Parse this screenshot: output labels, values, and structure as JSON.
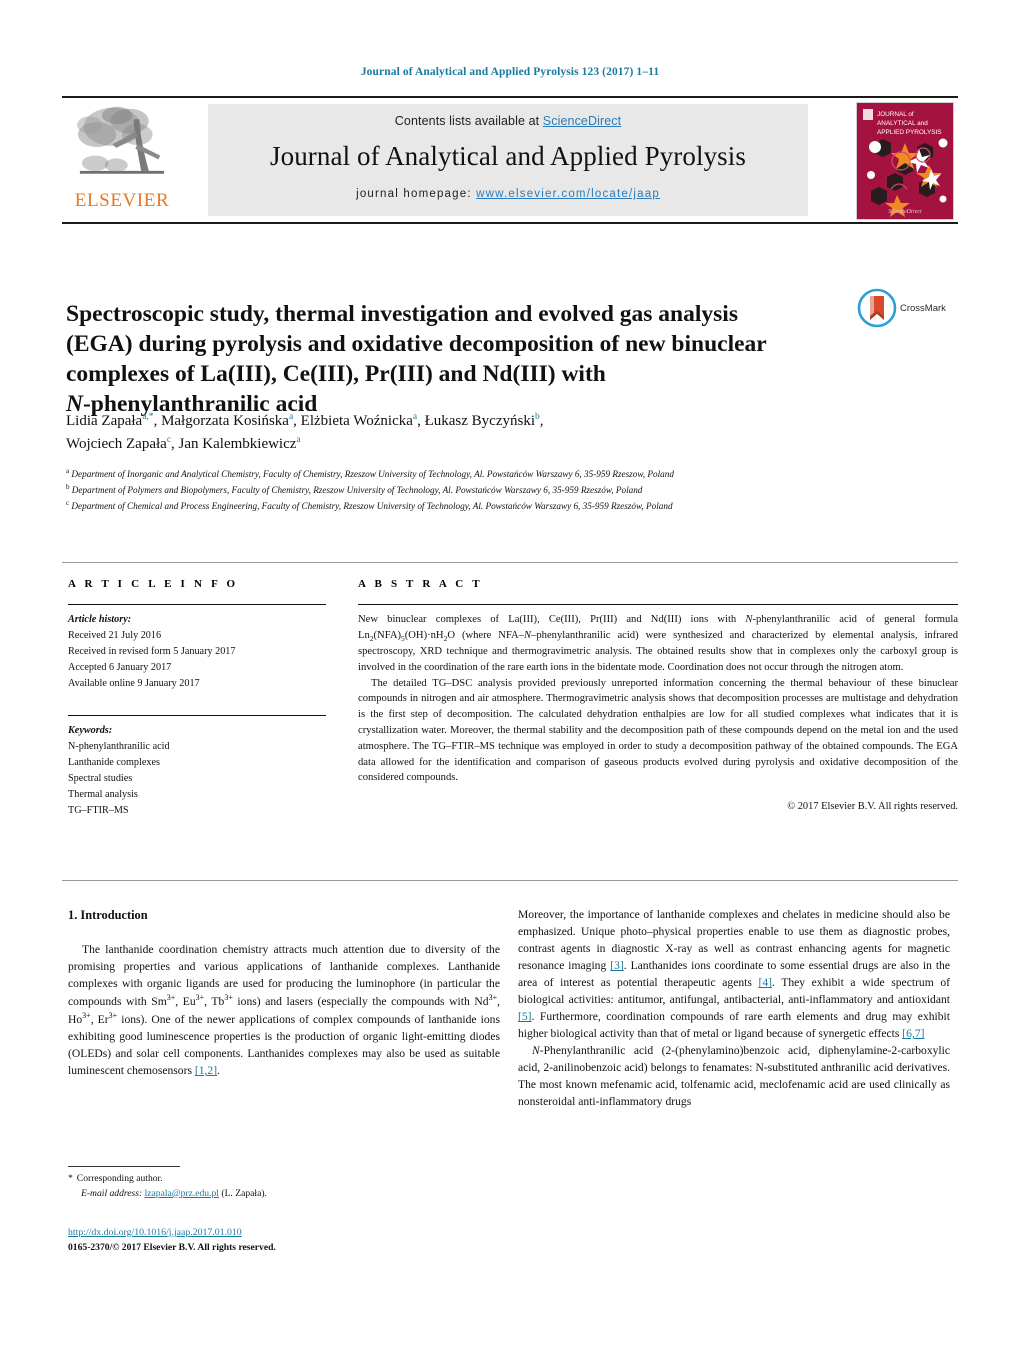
{
  "running_head": "Journal of Analytical and Applied Pyrolysis 123 (2017) 1–11",
  "masthead": {
    "contents_prefix": "Contents lists available at ",
    "sciencedirect": "ScienceDirect",
    "journal_name": "Journal of Analytical and Applied Pyrolysis",
    "homepage_label": "journal homepage: ",
    "homepage_url": "www.elsevier.com/locate/jaap",
    "publisher": "ELSEVIER",
    "cover_title_line1": "JOURNAL of",
    "cover_title_line2": "ANALYTICAL and",
    "cover_title_line3": "APPLIED PYROLYSIS",
    "cover_color": "#a4123f",
    "link_color": "#2b7bb9",
    "panel_color": "#e8e8e8"
  },
  "article": {
    "title_line1": "Spectroscopic study, thermal investigation and evolved gas analysis",
    "title_line2": "(EGA) during pyrolysis and oxidative decomposition of new binuclear",
    "title_line3": "complexes of La(III), Ce(III), Pr(III) and Nd(III) with",
    "title_line4_italic": "N",
    "title_line4_rest": "-phenylanthranilic acid",
    "crossmark_label": "CrossMark",
    "authors_line1": "Lidia Zapała",
    "authors_line1_sup1": "a,*",
    "authors_line1_b": ", Małgorzata Kosińska",
    "authors_line1_sup2": "a",
    "authors_line1_c": ", Elżbieta Woźnicka",
    "authors_line1_sup3": "a",
    "authors_line1_d": ", Łukasz Byczyński",
    "authors_line1_sup4": "b",
    "authors_line1_e": ",",
    "authors_line2_a": "Wojciech Zapała",
    "authors_line2_sup1": "c",
    "authors_line2_b": ", Jan Kalembkiewicz",
    "authors_line2_sup2": "a",
    "affiliation_a_sup": "a",
    "affiliation_a": "Department of Inorganic and Analytical Chemistry, Faculty of Chemistry, Rzeszow University of Technology, Al. Powstańców Warszawy 6, 35-959 Rzeszow, Poland",
    "affiliation_b_sup": "b",
    "affiliation_b": "Department of Polymers and Biopolymers, Faculty of Chemistry, Rzeszow University of Technology, Al. Powstańców Warszawy 6, 35-959 Rzeszów, Poland",
    "affiliation_c_sup": "c",
    "affiliation_c": "Department of Chemical and Process Engineering, Faculty of Chemistry, Rzeszow University of Technology, Al. Powstańców Warszawy 6, 35-959 Rzeszów, Poland"
  },
  "article_info": {
    "heading": "A R T I C L E  I N F O",
    "history_label": "Article history:",
    "history": [
      "Received 21 July 2016",
      "Received in revised form 5 January 2017",
      "Accepted 6 January 2017",
      "Available online 9 January 2017"
    ],
    "keywords_label": "Keywords:",
    "keywords": [
      "N-phenylanthranilic acid",
      "Lanthanide complexes",
      "Spectral studies",
      "Thermal analysis",
      "TG–FTIR–MS"
    ]
  },
  "abstract": {
    "heading": "A B S T R A C T",
    "para1_part1": "New binuclear complexes of La(III), Ce(III), Pr(III) and Nd(III) ions with ",
    "para1_italic1": "N",
    "para1_part2": "-phenylanthranilic acid of general formula Ln",
    "para1_sub1": "2",
    "para1_part3": "(NFA)",
    "para1_sub2": "5",
    "para1_part4": "(OH)·nH",
    "para1_sub3": "2",
    "para1_part5": "O (where NFA–",
    "para1_italic2": "N",
    "para1_part6": "–phenylanthranilic acid) were synthesized and characterized by elemental analysis, infrared spectroscopy, XRD technique and thermogravimetric analysis. The obtained results show that in complexes only the carboxyl group is involved in the coordination of the rare earth ions in the bidentate mode. Coordination does not occur through the nitrogen atom.",
    "para2": "The detailed TG–DSC analysis provided previously unreported information concerning the thermal behaviour of these binuclear compounds in nitrogen and air atmosphere. Thermogravimetric analysis shows that decomposition processes are multistage and dehydration is the first step of decomposition. The calculated dehydration enthalpies are low for all studied complexes what indicates that it is crystallization water. Moreover, the thermal stability and the decomposition path of these compounds depend on the metal ion and the used atmosphere. The TG–FTIR–MS technique was employed in order to study a decomposition pathway of the obtained compounds. The EGA data allowed for the identification and comparison of gaseous products evolved during pyrolysis and oxidative decomposition of the considered compounds.",
    "copyright": "© 2017 Elsevier B.V. All rights reserved."
  },
  "introduction": {
    "section_title": "1. Introduction",
    "left_para1_a": "The lanthanide coordination chemistry attracts much attention due to diversity of the promising properties and various applications of lanthanide complexes. Lanthanide complexes with organic ligands are used for producing the luminophore (in particular the compounds with Sm",
    "left_sup1": "3+",
    "left_para1_b": ", Eu",
    "left_sup2": "3+",
    "left_para1_c": ", Tb",
    "left_sup3": "3+",
    "left_para1_d": " ions) and lasers (especially the compounds with Nd",
    "left_sup4": "3+",
    "left_para1_e": ", Ho",
    "left_sup5": "3+",
    "left_para1_f": ", Er",
    "left_sup6": "3+",
    "left_para1_g": " ions). One of the newer applications of complex compounds of lanthanide ions exhibiting good luminescence properties is the production of organic light-emitting diodes (OLEDs) and solar cell components. Lanthanides complexes may also be used as suitable luminescent chemosensors ",
    "left_ref1": "[1,2]",
    "left_para1_h": ".",
    "right_para1_a": "Moreover, the importance of lanthanide complexes and chelates in medicine should also be emphasized. Unique photo–physical properties enable to use them as diagnostic probes, contrast agents in diagnostic X-ray as well as contrast enhancing agents for magnetic resonance imaging ",
    "right_ref1": "[3]",
    "right_para1_b": ". Lanthanides ions coordinate to some essential drugs are also in the area of interest as potential therapeutic agents ",
    "right_ref2": "[4]",
    "right_para1_c": ". They exhibit a wide spectrum of biological activities: antitumor, antifungal, antibacterial, anti-inflammatory and antioxidant ",
    "right_ref3": "[5]",
    "right_para1_d": ". Furthermore, coordination compounds of rare earth elements and drug may exhibit higher biological activity than that of metal or ligand because of synergetic effects ",
    "right_ref4": "[6,7]",
    "right_para2_italic": "N",
    "right_para2": "-Phenylanthranilic acid (2-(phenylamino)benzoic acid, diphenylamine-2-carboxylic acid, 2-anilinobenzoic acid) belongs to fenamates: N-substituted anthranilic acid derivatives. The most known mefenamic acid, tolfenamic acid, meclofenamic acid are used clinically as nonsteroidal anti-inflammatory drugs"
  },
  "footer": {
    "corresponding_star": "*",
    "corresponding_label": "Corresponding author.",
    "email_label": "E-mail address:",
    "email": "lzapala@prz.edu.pl",
    "email_owner": "(L. Zapała).",
    "doi": "http://dx.doi.org/10.1016/j.jaap.2017.01.010",
    "issn_line": "0165-2370/© 2017 Elsevier B.V. All rights reserved."
  }
}
